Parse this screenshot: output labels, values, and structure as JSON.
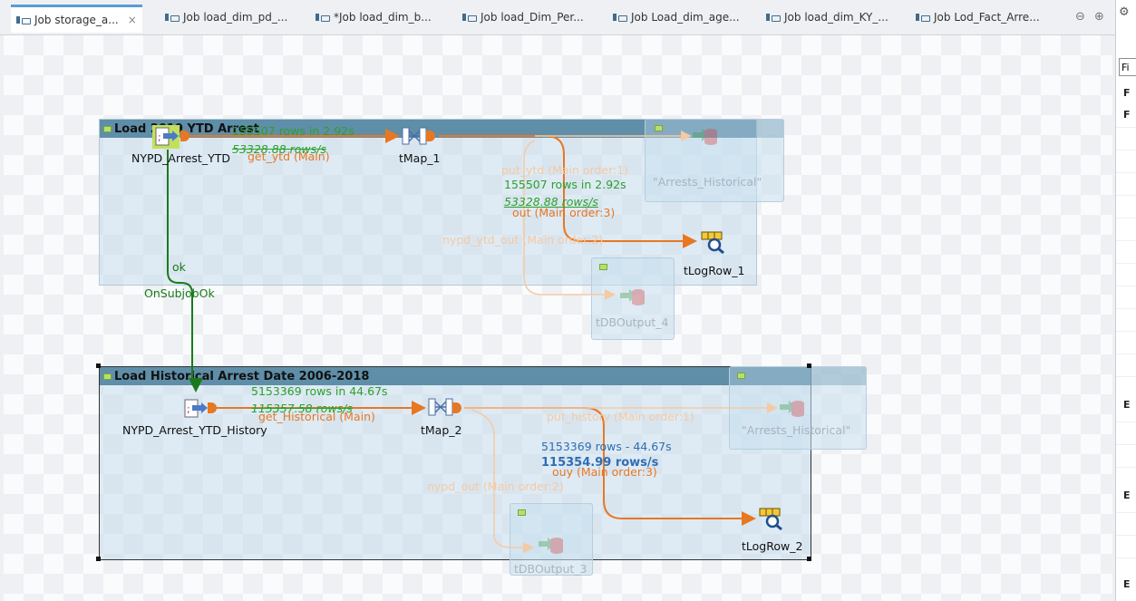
{
  "tabs": [
    {
      "label": "Job storage_a...",
      "active": true,
      "close": "×"
    },
    {
      "label": "Job load_dim_pd_..."
    },
    {
      "label": "*Job load_dim_b..."
    },
    {
      "label": "Job load_Dim_Per..."
    },
    {
      "label": "Job Load_dim_age..."
    },
    {
      "label": "Job load_dim_KY_..."
    },
    {
      "label": "Job Lod_Fact_Arre..."
    }
  ],
  "window_controls": {
    "minimize": "⊖",
    "maximize": "⊕"
  },
  "right_panel": {
    "icon": "palette-icon",
    "field_value": "Fi",
    "letters": [
      "F",
      "F",
      "E",
      "E",
      "E"
    ]
  },
  "subjob1": {
    "title": "Load 2019 YTD Arrest",
    "source": "NYPD_Arrest_YTD",
    "map": "tMap_1",
    "log": "tLogRow_1",
    "output_ghost": "\"Arrests_Historical\"",
    "db_ghost": "tDBOutput_4",
    "stats_in_rows": "155507 rows in 2.92s",
    "stats_in_rate": "53328.88 rows/s",
    "link_in": "get_ytd (Main)",
    "stats_out_rows": "155507 rows in 2.92s",
    "stats_out_rate": "53328.88 rows/s",
    "link_out": "out (Main order:3)",
    "link_put": "put_ytd (Main order:1)",
    "link_db": "nypd_ytd_out (Main order:2)",
    "trigger_ok": "ok",
    "trigger_label": "OnSubjobOk"
  },
  "subjob2": {
    "title": "Load Historical Arrest Date 2006-2018",
    "source": "NYPD_Arrest_YTD_History",
    "map": "tMap_2",
    "log": "tLogRow_2",
    "output_ghost": "\"Arrests_Historical\"",
    "db_ghost": "tDBOutput_3",
    "stats_in_rows": "5153369 rows in 44.67s",
    "stats_in_rate": "115357.58 rows/s",
    "link_in": "get_Historical (Main)",
    "stats_out_rows": "5153369 rows - 44.67s",
    "stats_out_rate": "115354.99 rows/s",
    "link_out": "ouy (Main order:3)",
    "link_put": "put_history (Main order:1)",
    "link_db": "nypd_out (Main order:2)"
  },
  "colors": {
    "flow": "#e87722",
    "trigger": "#1a7a1a",
    "stats": "#2ca02c",
    "stats_bold": "#2e6db4"
  }
}
